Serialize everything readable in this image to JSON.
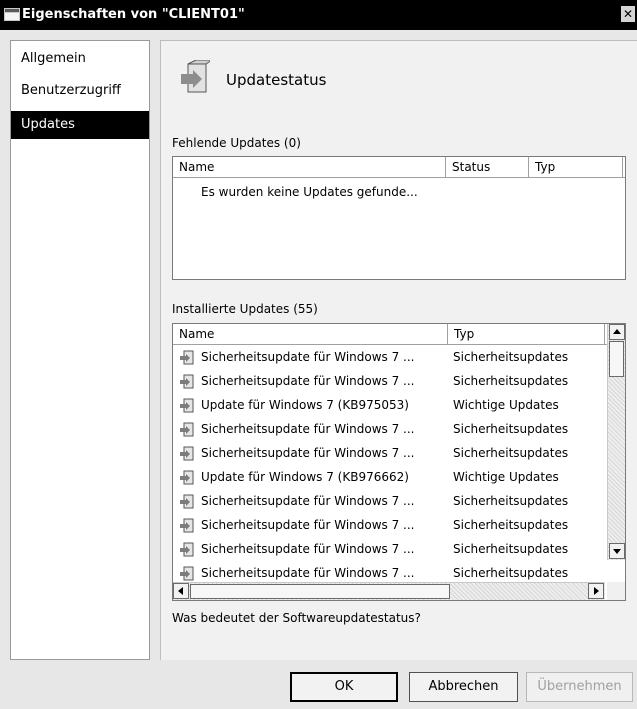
{
  "window": {
    "title": "Eigenschaften von \"CLIENT01\"",
    "close_label": "✕"
  },
  "nav": {
    "items": [
      {
        "label": "Allgemein",
        "selected": false
      },
      {
        "label": "Benutzerzugriff",
        "selected": false
      },
      {
        "label": "Updates",
        "selected": true
      }
    ]
  },
  "header": {
    "title": "Updatestatus",
    "icon": "update-package-icon"
  },
  "missing": {
    "label": "Fehlende Updates (0)",
    "columns": [
      "Name",
      "Status",
      "Typ"
    ],
    "empty_text": "Es wurden keine Updates gefunde..."
  },
  "installed": {
    "label": "Installierte Updates (55)",
    "columns": [
      "Name",
      "Typ"
    ],
    "rows": [
      {
        "name": "Sicherheitsupdate für Windows 7 ...",
        "typ": "Sicherheitsupdates"
      },
      {
        "name": "Sicherheitsupdate für Windows 7 ...",
        "typ": "Sicherheitsupdates"
      },
      {
        "name": "Update für Windows 7 (KB975053)",
        "typ": "Wichtige Updates"
      },
      {
        "name": "Sicherheitsupdate für Windows 7 ...",
        "typ": "Sicherheitsupdates"
      },
      {
        "name": "Sicherheitsupdate für Windows 7 ...",
        "typ": "Sicherheitsupdates"
      },
      {
        "name": "Update für Windows 7 (KB976662)",
        "typ": "Wichtige Updates"
      },
      {
        "name": "Sicherheitsupdate für Windows 7 ...",
        "typ": "Sicherheitsupdates"
      },
      {
        "name": "Sicherheitsupdate für Windows 7 ...",
        "typ": "Sicherheitsupdates"
      },
      {
        "name": "Sicherheitsupdate für Windows 7 ...",
        "typ": "Sicherheitsupdates"
      },
      {
        "name": "Sicherheitsupdate für Windows 7 ...",
        "typ": "Sicherheitsupdates"
      }
    ]
  },
  "help_link": "Was bedeutet der Softwareupdatestatus?",
  "buttons": {
    "ok": "OK",
    "cancel": "Abbrechen",
    "apply": "Übernehmen"
  },
  "colors": {
    "selection": "#000000",
    "titlebar": "#000000",
    "panel": "#f1f1f1"
  }
}
